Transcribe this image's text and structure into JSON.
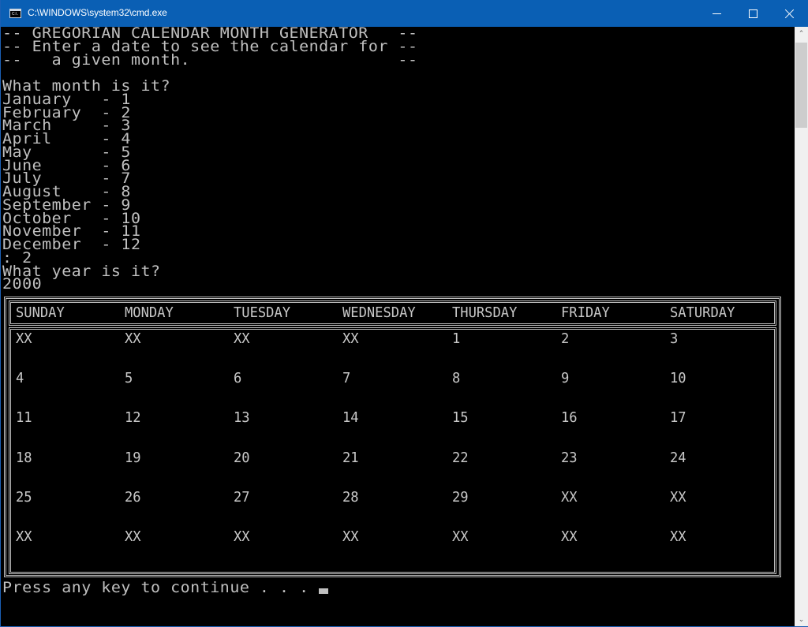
{
  "window": {
    "title": "C:\\WINDOWS\\system32\\cmd.exe",
    "icon": "cmd-icon",
    "icon_text": "C:\\."
  },
  "console": {
    "banner": [
      "-- GREGORIAN CALENDAR MONTH GENERATOR   --",
      "-- Enter a date to see the calendar for --",
      "--   a given month.                     --"
    ],
    "month_prompt": "What month is it?",
    "months": [
      "January   - 1",
      "February  - 2",
      "March     - 3",
      "April     - 4",
      "May       - 5",
      "June      - 6",
      "July      - 7",
      "August    - 8",
      "September - 9",
      "October   - 10",
      "November  - 11",
      "December  - 12"
    ],
    "month_input": ": 2",
    "year_prompt": "What year is it?",
    "year_input": "2000",
    "press_key": "Press any key to continue . . . "
  },
  "calendar": {
    "days": [
      "SUNDAY",
      "MONDAY",
      "TUESDAY",
      "WEDNESDAY",
      "THURSDAY",
      "FRIDAY",
      "SATURDAY"
    ],
    "weeks": [
      [
        "XX",
        "XX",
        "XX",
        "XX",
        "1",
        "2",
        "3"
      ],
      [
        "4",
        "5",
        "6",
        "7",
        "8",
        "9",
        "10"
      ],
      [
        "11",
        "12",
        "13",
        "14",
        "15",
        "16",
        "17"
      ],
      [
        "18",
        "19",
        "20",
        "21",
        "22",
        "23",
        "24"
      ],
      [
        "25",
        "26",
        "27",
        "28",
        "29",
        "XX",
        "XX"
      ],
      [
        "XX",
        "XX",
        "XX",
        "XX",
        "XX",
        "XX",
        "XX"
      ]
    ]
  },
  "scrollbar": {
    "up_glyph": "⌃",
    "down_glyph": "⌄"
  }
}
